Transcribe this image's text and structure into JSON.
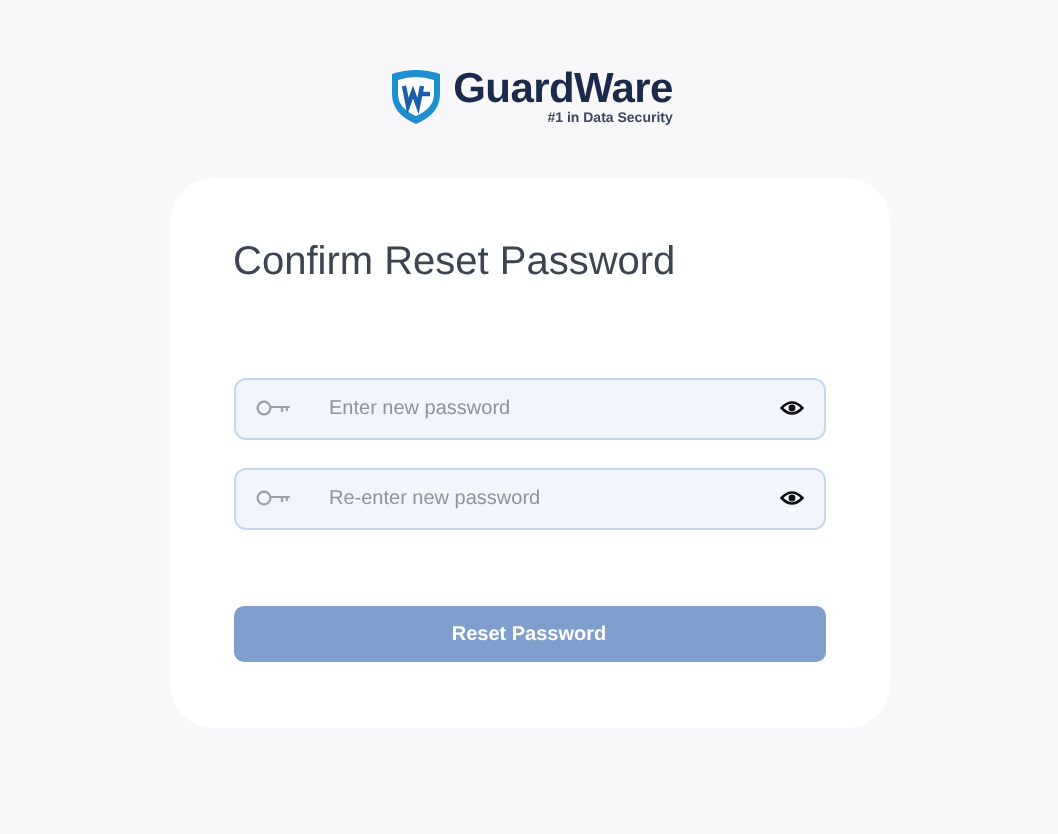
{
  "brand": {
    "name": "GuardWare",
    "tagline": "#1 in Data Security"
  },
  "title": "Confirm Reset Password",
  "fields": [
    {
      "placeholder": "Enter new password"
    },
    {
      "placeholder": "Re-enter new password"
    }
  ],
  "submit": {
    "label": "Reset Password",
    "disabled": true
  }
}
